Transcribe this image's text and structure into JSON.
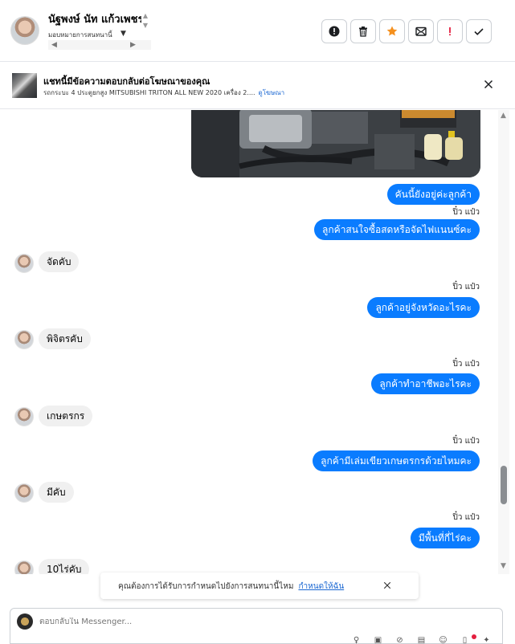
{
  "header": {
    "contact_name": "นัฐพงษ์ นัท แก้วเพชร",
    "assign_label": "มอบหมายการสนทนานี้",
    "actions": [
      {
        "name": "spam-button",
        "icon": "alert-circle-icon"
      },
      {
        "name": "delete-button",
        "icon": "trash-icon"
      },
      {
        "name": "star-button",
        "icon": "star-icon"
      },
      {
        "name": "mark-unread-button",
        "icon": "envelope-icon"
      },
      {
        "name": "flag-button",
        "icon": "exclamation-icon"
      },
      {
        "name": "done-button",
        "icon": "check-icon"
      }
    ]
  },
  "ad_banner": {
    "title": "แชทนี้มีข้อความตอบกลับต่อโฆษณาของคุณ",
    "subtitle": "รถกระบะ 4 ประตูยกสูง MITSUBISHI TRITON ALL NEW 2020 เครื่อง 2....",
    "link": "ดูโฆษณา"
  },
  "messages": [
    {
      "dir": "out",
      "text": "คันนี้ยังอยู่ค่ะลูกค้า",
      "sender": "ปิ๋ว แป๋ว"
    },
    {
      "dir": "out",
      "text": "ลูกค้าสนใจซื้อสดหรือจัดไฟแนนซ์คะ"
    },
    {
      "dir": "in",
      "text": "จัดคับ"
    },
    {
      "dir": "out",
      "text": "ลูกค้าอยู่จังหวัดอะไรคะ",
      "sender": "ปิ๋ว แป๋ว"
    },
    {
      "dir": "in",
      "text": "พิจิตรคับ"
    },
    {
      "dir": "out",
      "text": "ลูกค้าทำอาชีพอะไรคะ",
      "sender": "ปิ๋ว แป๋ว"
    },
    {
      "dir": "in",
      "text": "เกษตรกร"
    },
    {
      "dir": "out",
      "text": "ลูกค้ามีเล่มเขียวเกษตรกรด้วยไหมคะ",
      "sender": "ปิ๋ว แป๋ว"
    },
    {
      "dir": "in",
      "text": "มีคับ"
    },
    {
      "dir": "out",
      "text": "มีพื้นที่กี่ไร่คะ",
      "sender": "ปิ๋ว แป๋ว"
    },
    {
      "dir": "in",
      "text": "10ไร่คับ"
    }
  ],
  "notice": {
    "text": "คุณต้องการได้รับการกำหนดไปยังการสนทนานี้ไหม",
    "link": "กำหนดให้ฉัน"
  },
  "composer": {
    "placeholder": "ตอบกลับใน Messenger..."
  },
  "colors": {
    "outgoing_bubble": "#0a7cff",
    "incoming_bubble": "#f0f0f0",
    "star": "#f5901e",
    "link": "#1a67d2"
  }
}
